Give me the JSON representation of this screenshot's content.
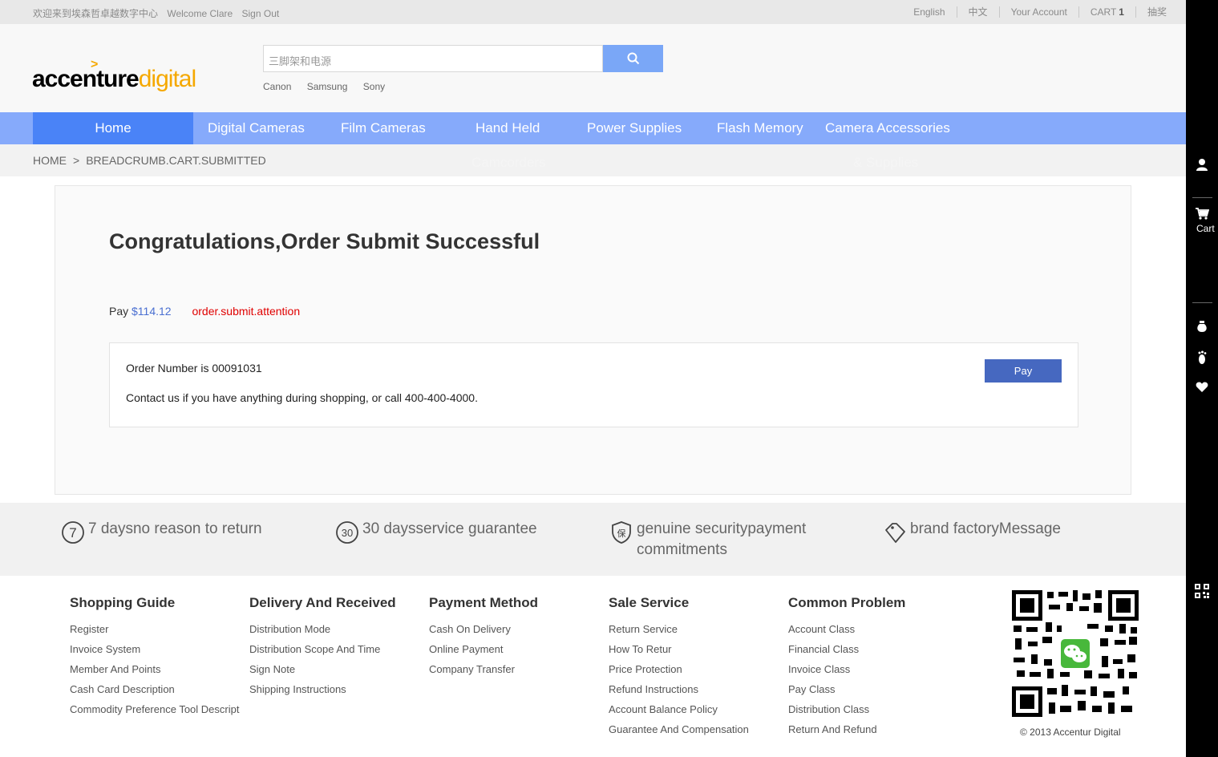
{
  "topbar": {
    "welcome_cn": "欢迎来到埃森哲卓越数字中心",
    "welcome": "Welcome Clare",
    "sign_out": "Sign Out",
    "english": "English",
    "chinese": "中文",
    "account": "Your Account",
    "cart": "CART",
    "cart_count": "1",
    "lottery": "抽奖"
  },
  "logo": {
    "part1": "accenture",
    "part2": "digital"
  },
  "search": {
    "placeholder": "三脚架和电源",
    "hotwords": [
      "Canon",
      "Samsung",
      "Sony"
    ]
  },
  "nav": {
    "items": [
      "Home",
      "Digital Cameras",
      "Film Cameras",
      "Hand Held",
      "Power Supplies",
      "Flash Memory",
      "Camera Accessories"
    ],
    "wrapped": [
      "Camcorders",
      "& Supplies"
    ]
  },
  "breadcrumb": {
    "home": "HOME",
    "sep": ">",
    "current": "BREADCRUMB.CART.SUBMITTED"
  },
  "order": {
    "title": "Congratulations,Order Submit Successful",
    "pay_label": "Pay",
    "amount": "$114.12",
    "attention": "order.submit.attention",
    "order_number": "Order Number is 00091031",
    "contact": "Contact us if you have anything during shopping, or call 400-400-4000.",
    "pay_button": "Pay"
  },
  "guarantees": [
    {
      "icon": "seven-days-icon",
      "label": "7 daysno reason to return"
    },
    {
      "icon": "thirty-days-icon",
      "label": "30 daysservice guarantee"
    },
    {
      "icon": "shield-icon",
      "label": "genuine securitypayment commitments"
    },
    {
      "icon": "tag-icon",
      "label": "brand factoryMessage"
    }
  ],
  "footer": {
    "columns": [
      {
        "title": "Shopping Guide",
        "links": [
          "Register",
          "Invoice System",
          "Member And Points",
          "Cash Card Description",
          "Commodity Preference Tool Descript"
        ]
      },
      {
        "title": "Delivery And Received",
        "links": [
          "Distribution Mode",
          "Distribution Scope And Time",
          "Sign Note",
          "Shipping Instructions"
        ]
      },
      {
        "title": "Payment Method",
        "links": [
          "Cash On Delivery",
          "Online Payment",
          "Company Transfer"
        ]
      },
      {
        "title": "Sale Service",
        "links": [
          "Return Service",
          "How To Retur",
          "Price Protection",
          "Refund Instructions",
          "Account Balance Policy",
          "Guarantee And Compensation"
        ]
      },
      {
        "title": "Common Problem",
        "links": [
          "Account Class",
          "Financial Class",
          "Invoice Class",
          "Pay Class",
          "Distribution Class",
          "Return And Refund"
        ]
      }
    ],
    "copyright": "© 2013 Accentur Digital"
  },
  "sidebar": {
    "cart_label": "Cart"
  },
  "colors": {
    "nav": "#86aafb",
    "nav_active": "#4a83f7",
    "pay_button": "#4668c0",
    "accent_logo": "#f5a800",
    "attention": "#e00000"
  }
}
